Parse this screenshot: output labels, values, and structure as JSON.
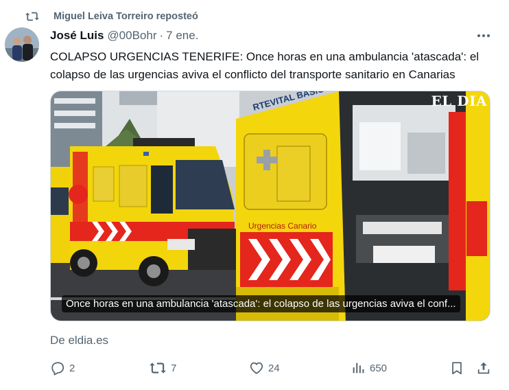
{
  "repost": {
    "label": "Miguel Leiva Torreiro reposteó"
  },
  "tweet": {
    "author_name": "José Luis",
    "handle": "@00Bohr",
    "separator": "·",
    "date": "7 ene.",
    "text": "COLAPSO URGENCIAS TENERIFE: Once horas en una ambulancia 'atascada': el colapso de las urgencias aviva el conflicto del transporte sanitario en Canarias"
  },
  "card": {
    "caption": "Once horas en una ambulancia 'atascada': el colapso de las urgencias aviva el conf...",
    "watermark": "EL DIA",
    "ambulance_label": "RTEVITAL BASICO",
    "ambulance_side_label": "Urgencias Canario",
    "source": "De eldia.es"
  },
  "actions": {
    "replies": "2",
    "reposts": "7",
    "likes": "24",
    "views": "650"
  },
  "colors": {
    "text": "#0f1419",
    "secondary": "#536471",
    "border": "#cfd9de",
    "ambulance_yellow": "#f5d90a",
    "ambulance_red": "#e4261c"
  }
}
